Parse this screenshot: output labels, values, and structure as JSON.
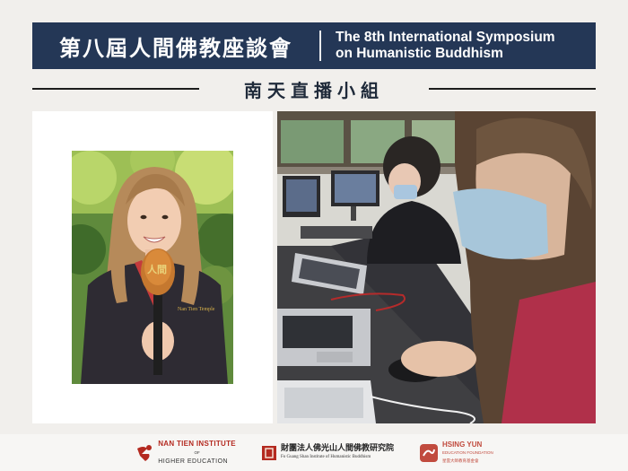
{
  "header": {
    "title_zh": "第八屆人間佛教座談會",
    "title_en_line1": "The 8th International Symposium",
    "title_en_line2": "on Humanistic Buddhism"
  },
  "subtitle": "南天直播小組",
  "photos": {
    "left_mic_text": "人間",
    "left_jacket_text": "Nan Tien Temple"
  },
  "footer": {
    "ntu_line1": "NAN TIEN INSTITUTE",
    "ntu_line2": "OF",
    "ntu_line3": "HIGHER EDUCATION",
    "fgs_line1": "財團法人佛光山人間佛教研究院",
    "fgs_line2": "Fo Guang Shan Institute of Humanistic Buddhism",
    "hy_line1": "HSING YUN",
    "hy_line2": "EDUCATION FOUNDATION",
    "hy_line3": "星雲大師教育基金會"
  },
  "colors": {
    "header_bg": "#243756",
    "page_bg": "#f1efec",
    "brand_red": "#b42a20"
  }
}
